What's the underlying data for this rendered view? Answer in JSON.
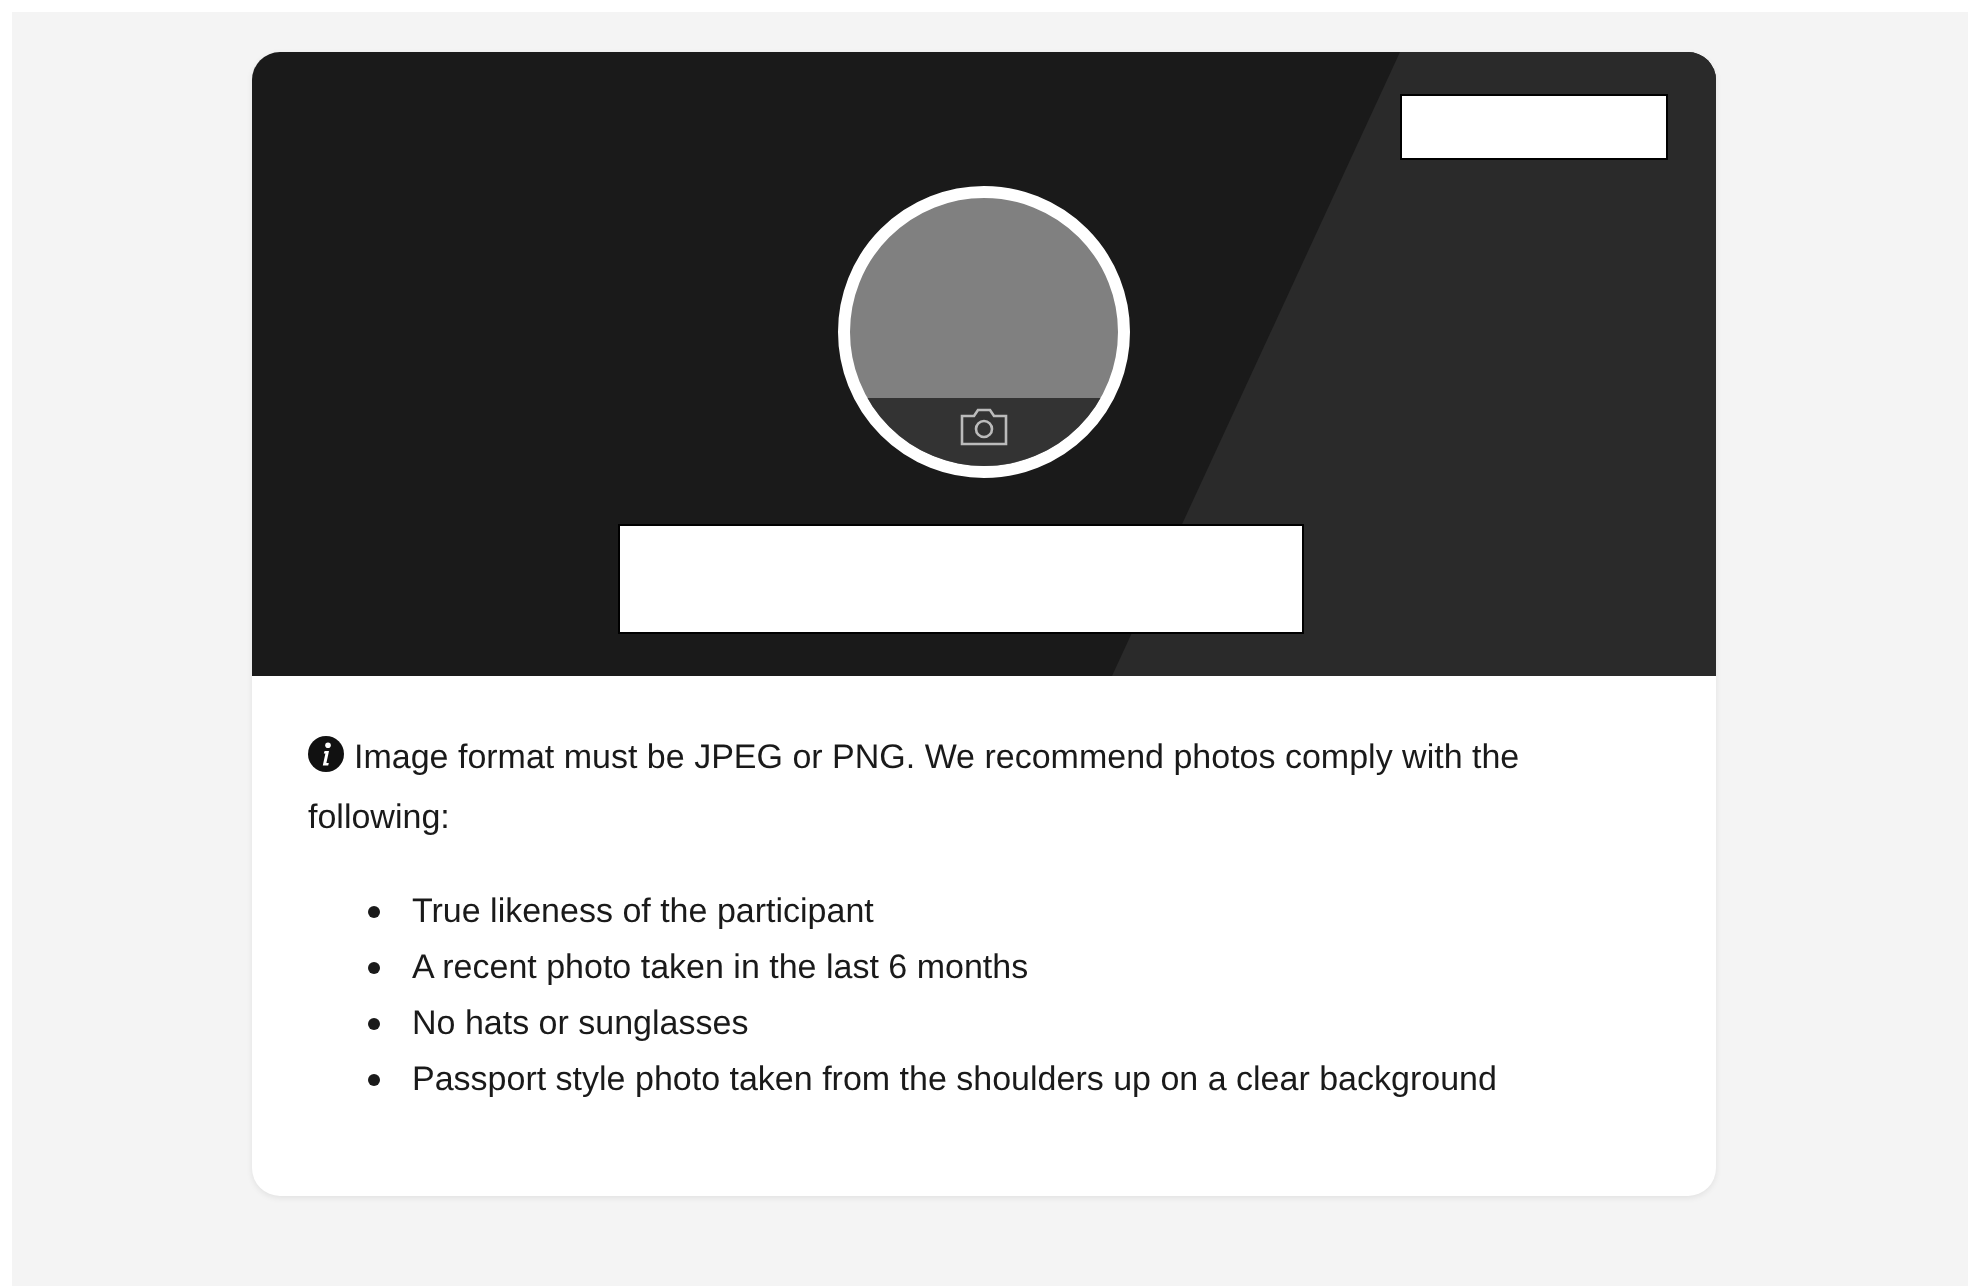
{
  "notice": {
    "text": "Image format must be JPEG or PNG. We recommend photos comply with the following:"
  },
  "requirements": [
    "True likeness of the participant",
    "A recent photo taken in the last 6 months",
    "No hats or sunglasses",
    "Passport style photo taken from the shoulders up on a clear background"
  ]
}
